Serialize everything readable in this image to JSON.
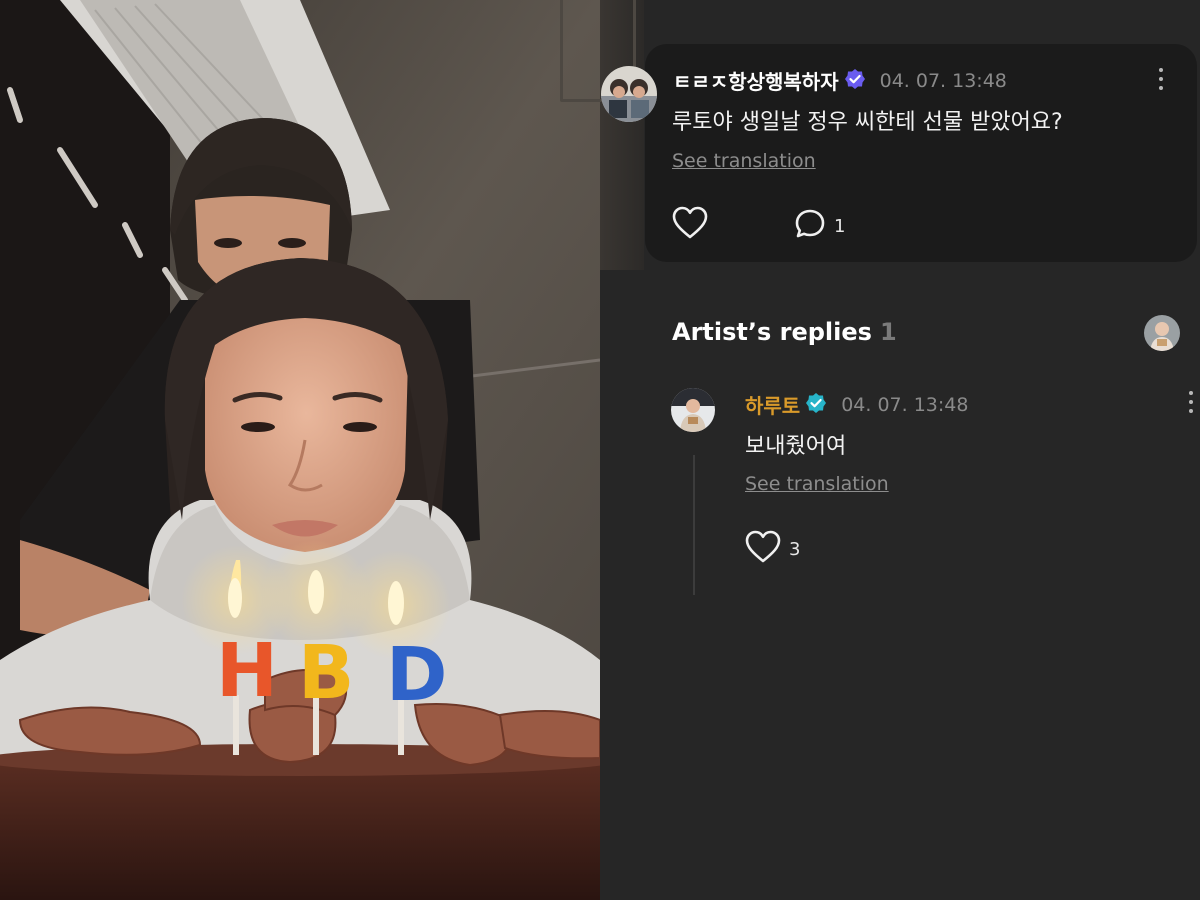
{
  "photo": {
    "candle_letters": [
      "H",
      "B",
      "D"
    ],
    "candle_colors": [
      "#e8562a",
      "#f2b71c",
      "#2f63c9"
    ]
  },
  "comment": {
    "username": "ㅌㄹㅈ항상행복하자",
    "timestamp": "04. 07. 13:48",
    "text": "루토야 생일날 정우 씨한테 선물 받았어요?",
    "see_translation": "See translation",
    "reply_count": "1",
    "icons": [
      "heart-icon",
      "comment-icon",
      "more-vertical-icon",
      "verified-badge-icon"
    ]
  },
  "replies_section": {
    "title": "Artist’s replies",
    "count": "1"
  },
  "reply": {
    "artist_name": "하루토",
    "timestamp": "04. 07. 13:48",
    "text": "보내줬어여",
    "see_translation": "See translation",
    "like_count": "3",
    "icons": [
      "heart-icon",
      "more-vertical-icon",
      "verified-badge-icon"
    ]
  },
  "colors": {
    "background": "#262626",
    "card": "#1b1b1b",
    "artist_name": "#d99a2a",
    "verified_user": "#6a5cf0",
    "verified_artist": "#27b4c9",
    "muted_text": "#8a8a8a"
  }
}
